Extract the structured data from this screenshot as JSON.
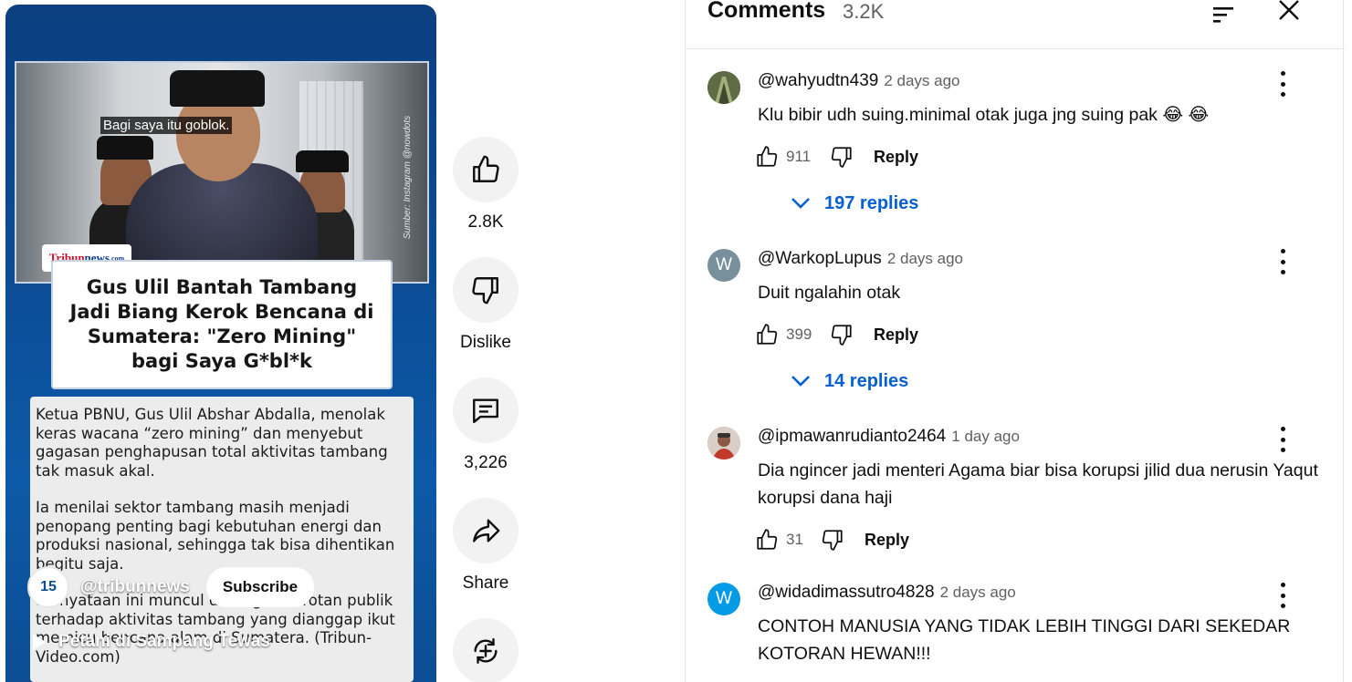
{
  "video": {
    "caption": "Bagi saya itu goblok.",
    "watermark": "Sumber: Instagram @nowdots",
    "logo_text_red": "Tribun",
    "logo_text_blue": "news",
    "logo_suffix": ".com",
    "headline": "Gus Ulil Bantah Tambang Jadi Biang Kerok Bencana di Sumatera: \"Zero Mining\" bagi Saya G*bl*k",
    "body_paragraphs": [
      "Ketua PBNU, Gus Ulil Abshar Abdalla, menolak keras wacana “zero mining” dan menyebut gagasan penghapusan total aktivitas tambang tak masuk akal.",
      "Ia menilai sektor tambang masih menjadi penopang penting bagi kebutuhan energi dan produksi nasional, sehingga tak bisa dihentikan begitu saja.",
      "Pernyataan ini muncul di tengah sorotan publik terhadap aktivitas tambang yang dianggap ikut memicu bencana alam di Sumatera. (Tribun-Video.com)"
    ],
    "channel_avatar": "15",
    "channel_handle": "@tribunnews",
    "subscribe_label": "Subscribe",
    "title": "Petani di Sampang Tewas"
  },
  "actions": {
    "like_count": "2.8K",
    "dislike_label": "Dislike",
    "comment_count": "3,226",
    "share_label": "Share"
  },
  "comments_panel": {
    "title": "Comments",
    "count": "3.2K",
    "comments": [
      {
        "author": "@wahyudtn439",
        "time": "2 days ago",
        "text": "Klu bibir udh suing.minimal otak juga jng suing pak 😂 😂",
        "likes": "911",
        "reply_label": "Reply",
        "replies_label": "197 replies",
        "avatar_letter": "",
        "avatar_color": "#6b7a4e"
      },
      {
        "author": "@WarkopLupus",
        "time": "2 days ago",
        "text": "Duit ngalahin otak",
        "likes": "399",
        "reply_label": "Reply",
        "replies_label": "14 replies",
        "avatar_letter": "W",
        "avatar_color": "#78909c"
      },
      {
        "author": "@ipmawanrudianto2464",
        "time": "1 day ago",
        "text": "Dia ngincer jadi menteri Agama biar bisa korupsi jilid dua nerusin Yaqut korupsi dana haji",
        "likes": "31",
        "reply_label": "Reply",
        "avatar_letter": "",
        "avatar_color": "#b38a7a"
      },
      {
        "author": "@widadimassutro4828",
        "time": "2 days ago",
        "text": "CONTOH MANUSIA YANG TIDAK LEBIH TINGGI DARI SEKEDAR KOTORAN HEWAN!!!",
        "avatar_letter": "W",
        "avatar_color": "#039be5"
      }
    ]
  }
}
